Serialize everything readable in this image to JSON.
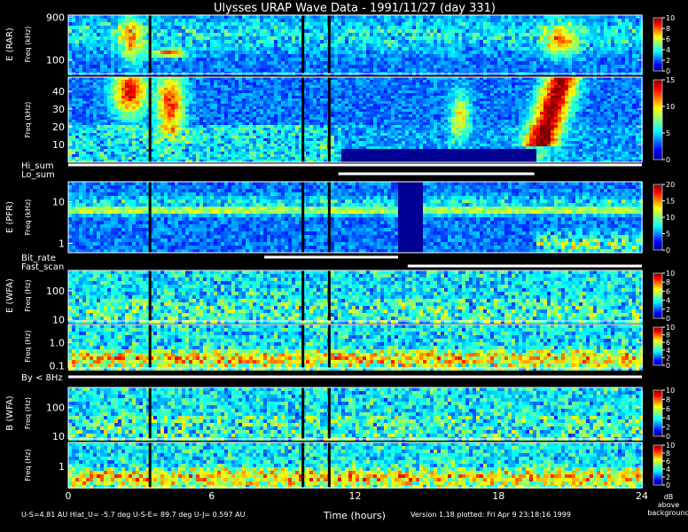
{
  "chart_data": {
    "type": "heatmap",
    "title": "Ulysses URAP Wave Data - 1991/11/27  (day 331)",
    "xlabel": "Time (hours)",
    "xlim": [
      0,
      24
    ],
    "x_ticks": [
      "0",
      "6",
      "12",
      "18",
      "24"
    ],
    "colorbar_unit_lines": [
      "dB",
      "above",
      "background"
    ],
    "panels": [
      {
        "id": "rar",
        "side_label": "E (RAR)",
        "ylabel": "Freq (kHz)",
        "scale": "log",
        "ylim": [
          50,
          1000
        ],
        "yticks": [
          {
            "value": 900,
            "label": "900"
          },
          {
            "value": 100,
            "label": "100"
          }
        ],
        "cbar_max": 10,
        "cbar_ticks": [
          "10",
          "8",
          "6",
          "4",
          "2",
          "0"
        ]
      },
      {
        "id": "rar_low",
        "ylabel": "Freq (kHz)",
        "scale": "linear",
        "ylim": [
          0,
          48
        ],
        "yticks": [
          {
            "value": 40,
            "label": "40"
          },
          {
            "value": 30,
            "label": "30"
          },
          {
            "value": 20,
            "label": "20"
          },
          {
            "value": 10,
            "label": "10"
          }
        ],
        "cbar_max": 15,
        "cbar_ticks": [
          "15",
          "10",
          "5",
          "0"
        ]
      },
      {
        "id": "pfr",
        "side_label": "E (PFR)",
        "ylabel": "Freq (kHz)",
        "scale": "log",
        "ylim": [
          0.6,
          30
        ],
        "yticks": [
          {
            "value": 10,
            "label": "10"
          },
          {
            "value": 1,
            "label": "1"
          }
        ],
        "cbar_max": 20,
        "cbar_ticks": [
          "20",
          "15",
          "10",
          "5",
          "0"
        ]
      },
      {
        "id": "wfa_e_high",
        "side_label": "E (WFA)",
        "ylabel": "Freq (Hz)",
        "scale": "log",
        "ylim": [
          9,
          500
        ],
        "yticks": [
          {
            "value": 100,
            "label": "100"
          },
          {
            "value": 10,
            "label": "10"
          }
        ],
        "cbar_max": 10,
        "cbar_ticks": [
          "10",
          "8",
          "6",
          "4",
          "2",
          "0"
        ]
      },
      {
        "id": "wfa_e_low",
        "ylabel": "Freq (Hz)",
        "scale": "log",
        "ylim": [
          0.08,
          6
        ],
        "yticks": [
          {
            "value": 1,
            "label": "1.0"
          },
          {
            "value": 0.1,
            "label": "0.1"
          }
        ],
        "cbar_max": 10,
        "cbar_ticks": [
          "10",
          "8",
          "6",
          "4",
          "2",
          "0"
        ]
      },
      {
        "id": "wfa_b_high",
        "side_label": "B (WFA)",
        "ylabel": "Freq (Hz)",
        "scale": "log",
        "ylim": [
          8,
          500
        ],
        "yticks": [
          {
            "value": 100,
            "label": "100"
          },
          {
            "value": 10,
            "label": "10"
          }
        ],
        "cbar_max": 10,
        "cbar_ticks": [
          "10",
          "8",
          "6",
          "4",
          "2",
          "0"
        ]
      },
      {
        "id": "wfa_b_low",
        "ylabel": "Freq (Hz)",
        "scale": "log",
        "ylim": [
          0.2,
          6
        ],
        "yticks": [
          {
            "value": 1,
            "label": "1"
          }
        ],
        "cbar_max": 10,
        "cbar_ticks": [
          "10",
          "8",
          "6",
          "4",
          "2",
          "0"
        ]
      }
    ],
    "mode_strips": [
      {
        "label": "Hi_sum",
        "label2": "Lo_sum",
        "segments_hi": [
          [
            0,
            24
          ]
        ],
        "segments_lo": [
          [
            11.3,
            19.5
          ]
        ]
      },
      {
        "label": "Bit_rate",
        "label2": "Fast_scan",
        "segments_hi": [
          [
            8.2,
            13.8
          ]
        ],
        "segments_lo": [
          [
            14.2,
            24
          ]
        ]
      },
      {
        "label": "By < 8Hz",
        "segments_hi": [
          [
            0,
            24
          ]
        ]
      }
    ],
    "footer_left": "U-S=4.81 AU   Hlat_U= -5.7 deg   U-S-E= 89.7 deg   U-J= 0.597 AU",
    "footer_right": "Version 1.18 plotted: Fri Apr  9 23:18:16 1999"
  }
}
